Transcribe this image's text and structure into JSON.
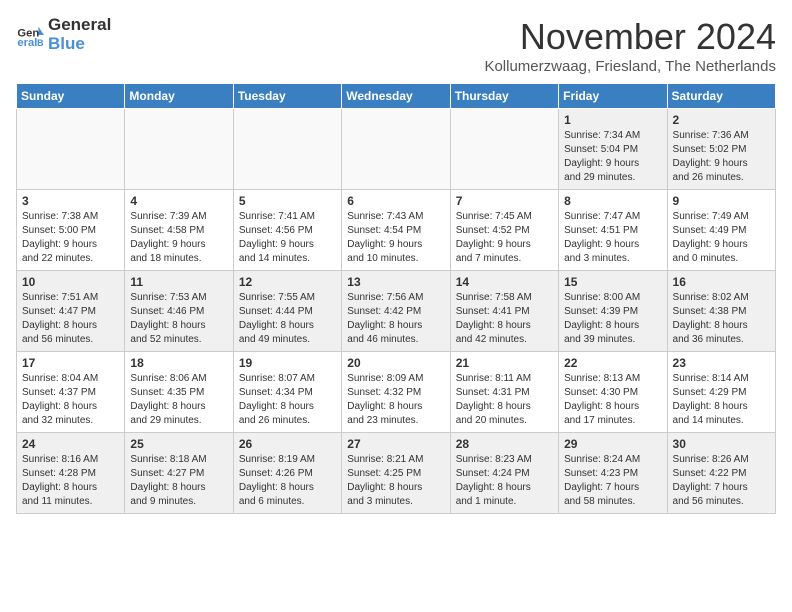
{
  "logo": {
    "line1": "General",
    "line2": "Blue"
  },
  "title": "November 2024",
  "location": "Kollumerzwaag, Friesland, The Netherlands",
  "headers": [
    "Sunday",
    "Monday",
    "Tuesday",
    "Wednesday",
    "Thursday",
    "Friday",
    "Saturday"
  ],
  "weeks": [
    [
      {
        "day": "",
        "info": ""
      },
      {
        "day": "",
        "info": ""
      },
      {
        "day": "",
        "info": ""
      },
      {
        "day": "",
        "info": ""
      },
      {
        "day": "",
        "info": ""
      },
      {
        "day": "1",
        "info": "Sunrise: 7:34 AM\nSunset: 5:04 PM\nDaylight: 9 hours\nand 29 minutes."
      },
      {
        "day": "2",
        "info": "Sunrise: 7:36 AM\nSunset: 5:02 PM\nDaylight: 9 hours\nand 26 minutes."
      }
    ],
    [
      {
        "day": "3",
        "info": "Sunrise: 7:38 AM\nSunset: 5:00 PM\nDaylight: 9 hours\nand 22 minutes."
      },
      {
        "day": "4",
        "info": "Sunrise: 7:39 AM\nSunset: 4:58 PM\nDaylight: 9 hours\nand 18 minutes."
      },
      {
        "day": "5",
        "info": "Sunrise: 7:41 AM\nSunset: 4:56 PM\nDaylight: 9 hours\nand 14 minutes."
      },
      {
        "day": "6",
        "info": "Sunrise: 7:43 AM\nSunset: 4:54 PM\nDaylight: 9 hours\nand 10 minutes."
      },
      {
        "day": "7",
        "info": "Sunrise: 7:45 AM\nSunset: 4:52 PM\nDaylight: 9 hours\nand 7 minutes."
      },
      {
        "day": "8",
        "info": "Sunrise: 7:47 AM\nSunset: 4:51 PM\nDaylight: 9 hours\nand 3 minutes."
      },
      {
        "day": "9",
        "info": "Sunrise: 7:49 AM\nSunset: 4:49 PM\nDaylight: 9 hours\nand 0 minutes."
      }
    ],
    [
      {
        "day": "10",
        "info": "Sunrise: 7:51 AM\nSunset: 4:47 PM\nDaylight: 8 hours\nand 56 minutes."
      },
      {
        "day": "11",
        "info": "Sunrise: 7:53 AM\nSunset: 4:46 PM\nDaylight: 8 hours\nand 52 minutes."
      },
      {
        "day": "12",
        "info": "Sunrise: 7:55 AM\nSunset: 4:44 PM\nDaylight: 8 hours\nand 49 minutes."
      },
      {
        "day": "13",
        "info": "Sunrise: 7:56 AM\nSunset: 4:42 PM\nDaylight: 8 hours\nand 46 minutes."
      },
      {
        "day": "14",
        "info": "Sunrise: 7:58 AM\nSunset: 4:41 PM\nDaylight: 8 hours\nand 42 minutes."
      },
      {
        "day": "15",
        "info": "Sunrise: 8:00 AM\nSunset: 4:39 PM\nDaylight: 8 hours\nand 39 minutes."
      },
      {
        "day": "16",
        "info": "Sunrise: 8:02 AM\nSunset: 4:38 PM\nDaylight: 8 hours\nand 36 minutes."
      }
    ],
    [
      {
        "day": "17",
        "info": "Sunrise: 8:04 AM\nSunset: 4:37 PM\nDaylight: 8 hours\nand 32 minutes."
      },
      {
        "day": "18",
        "info": "Sunrise: 8:06 AM\nSunset: 4:35 PM\nDaylight: 8 hours\nand 29 minutes."
      },
      {
        "day": "19",
        "info": "Sunrise: 8:07 AM\nSunset: 4:34 PM\nDaylight: 8 hours\nand 26 minutes."
      },
      {
        "day": "20",
        "info": "Sunrise: 8:09 AM\nSunset: 4:32 PM\nDaylight: 8 hours\nand 23 minutes."
      },
      {
        "day": "21",
        "info": "Sunrise: 8:11 AM\nSunset: 4:31 PM\nDaylight: 8 hours\nand 20 minutes."
      },
      {
        "day": "22",
        "info": "Sunrise: 8:13 AM\nSunset: 4:30 PM\nDaylight: 8 hours\nand 17 minutes."
      },
      {
        "day": "23",
        "info": "Sunrise: 8:14 AM\nSunset: 4:29 PM\nDaylight: 8 hours\nand 14 minutes."
      }
    ],
    [
      {
        "day": "24",
        "info": "Sunrise: 8:16 AM\nSunset: 4:28 PM\nDaylight: 8 hours\nand 11 minutes."
      },
      {
        "day": "25",
        "info": "Sunrise: 8:18 AM\nSunset: 4:27 PM\nDaylight: 8 hours\nand 9 minutes."
      },
      {
        "day": "26",
        "info": "Sunrise: 8:19 AM\nSunset: 4:26 PM\nDaylight: 8 hours\nand 6 minutes."
      },
      {
        "day": "27",
        "info": "Sunrise: 8:21 AM\nSunset: 4:25 PM\nDaylight: 8 hours\nand 3 minutes."
      },
      {
        "day": "28",
        "info": "Sunrise: 8:23 AM\nSunset: 4:24 PM\nDaylight: 8 hours\nand 1 minute."
      },
      {
        "day": "29",
        "info": "Sunrise: 8:24 AM\nSunset: 4:23 PM\nDaylight: 7 hours\nand 58 minutes."
      },
      {
        "day": "30",
        "info": "Sunrise: 8:26 AM\nSunset: 4:22 PM\nDaylight: 7 hours\nand 56 minutes."
      }
    ]
  ]
}
